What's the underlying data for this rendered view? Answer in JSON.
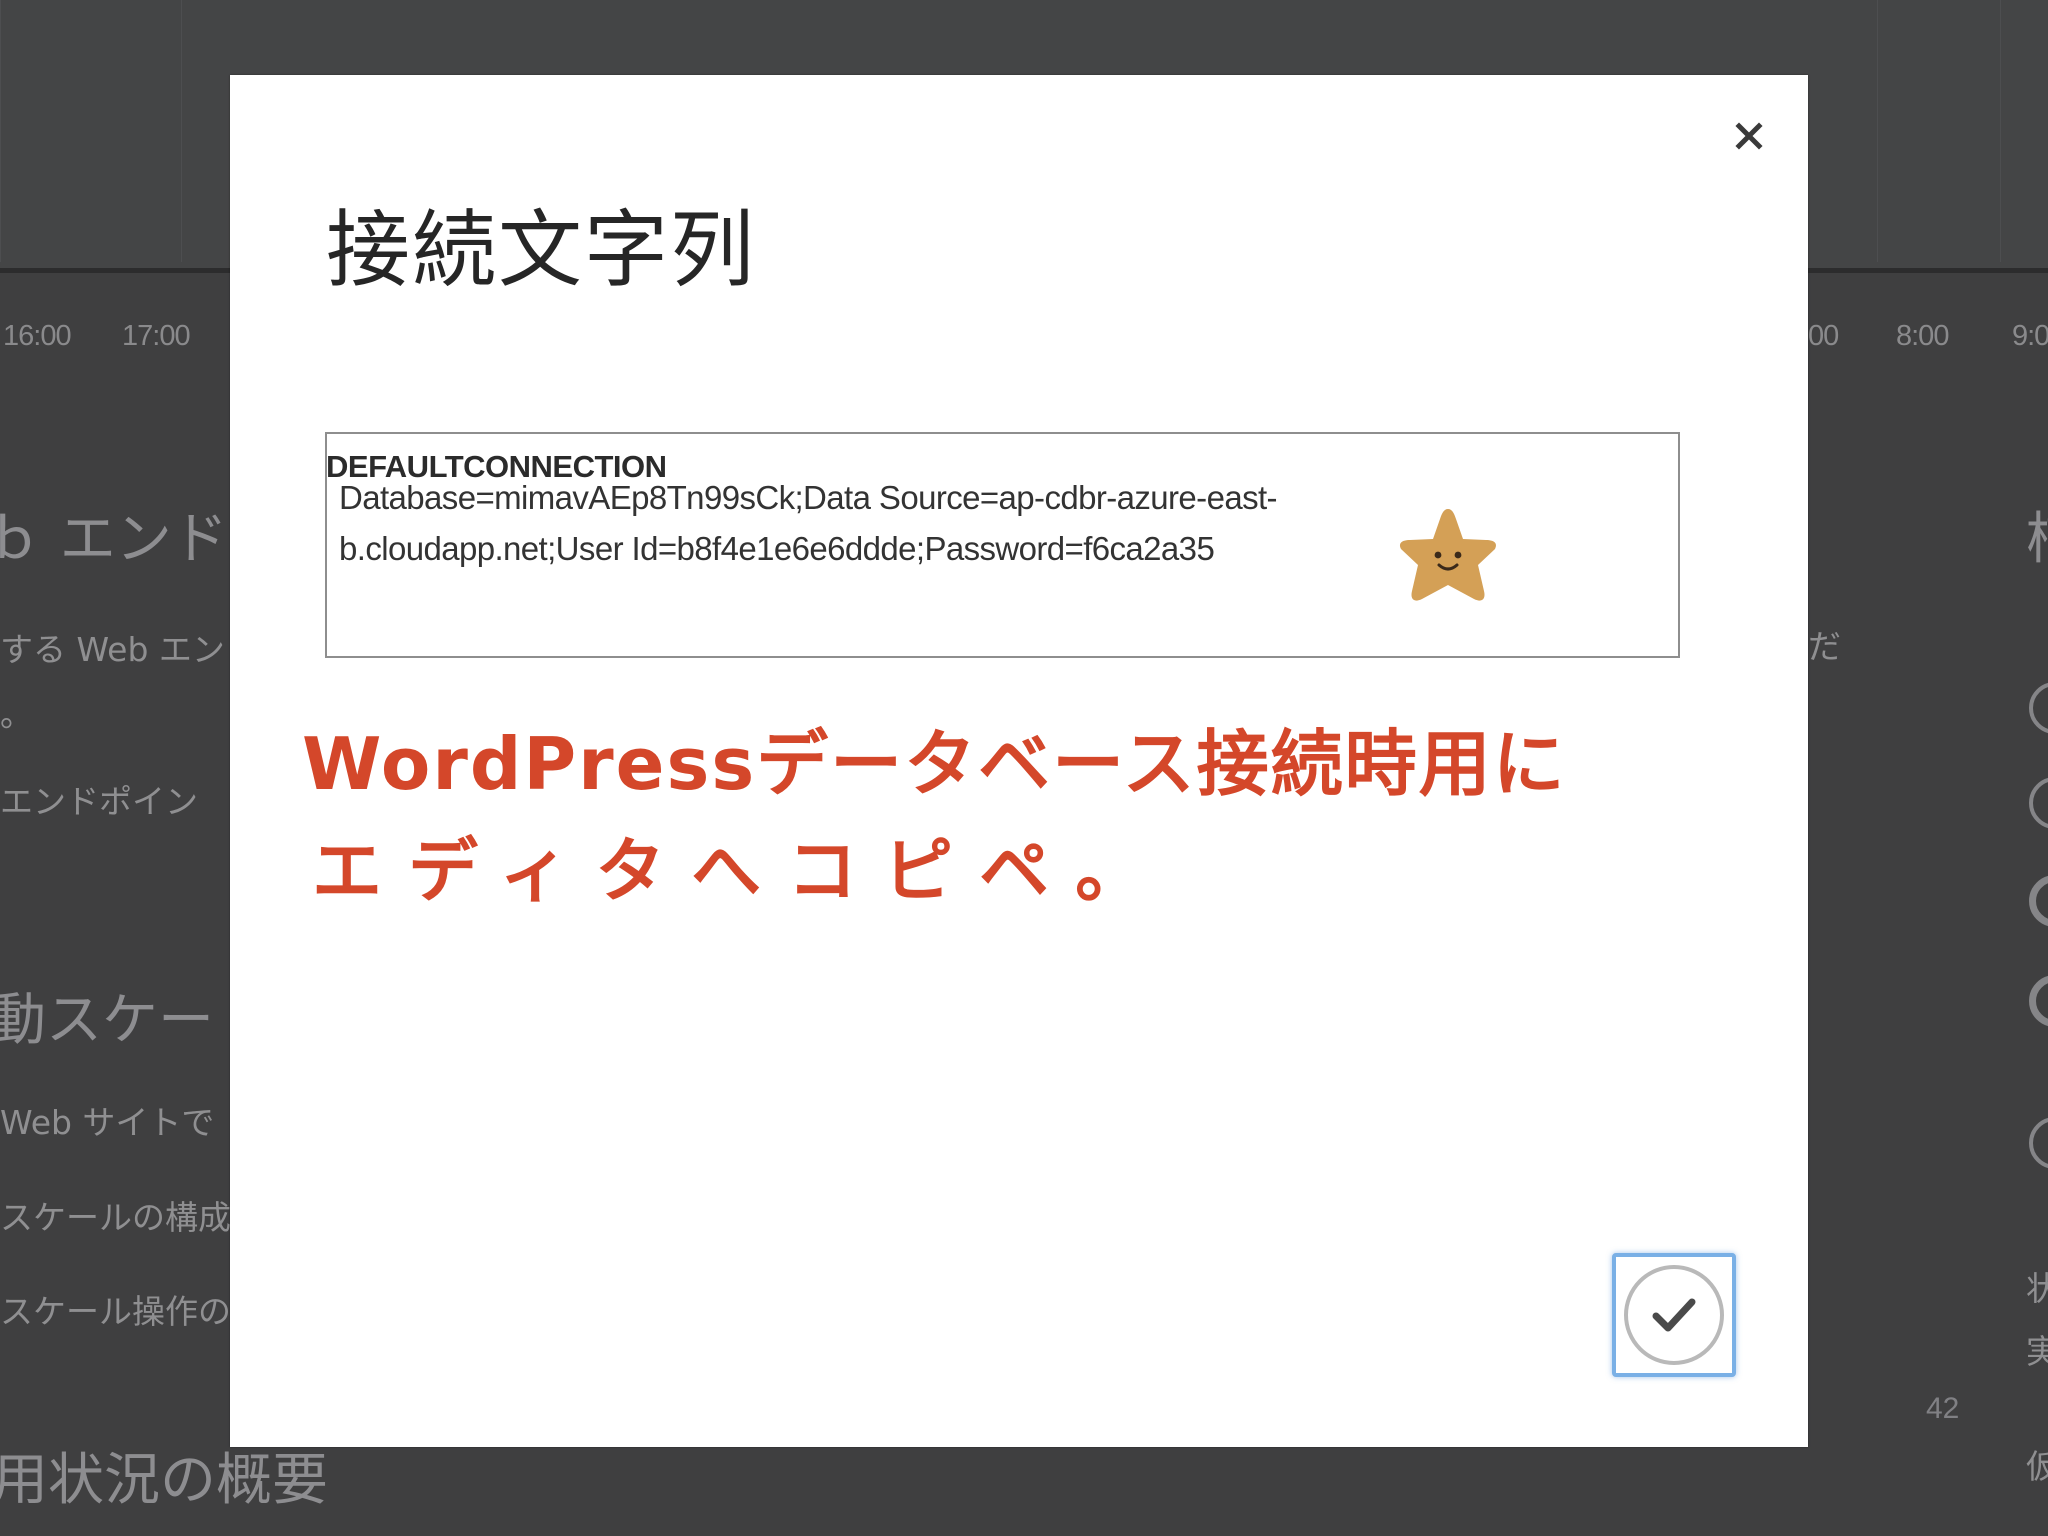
{
  "background": {
    "time_ticks": [
      "16:00",
      "17:00",
      "00",
      "8:00",
      "9:0"
    ],
    "left_texts": [
      "ｂ エンド",
      "する Web エン",
      "。",
      "エンドポイン",
      "動スケー",
      "Web サイトで",
      "スケールの構成",
      "スケール操作の",
      "用状況の概要"
    ],
    "right_texts": [
      "柿",
      "だ",
      "状",
      "実",
      "仮"
    ],
    "page_number": "42"
  },
  "dialog": {
    "title": "接続文字列",
    "field_label": "DEFAULTCONNECTION",
    "connection_string_lines": [
      "Database=mimavAEp8Tn99sCk;Data Source=ap-cdbr-azure-east-",
      "b.cloudapp.net;User Id=b8f4e1e6e6ddde;Password=f6ca2a35"
    ],
    "annotation_lines": [
      "WordPressデータベース接続時用に",
      "エディタへコピペ。"
    ],
    "close_icon": "close-x-icon",
    "confirm_icon": "checkmark-circle-icon",
    "sticker_icon": "smiling-star-icon"
  },
  "colors": {
    "overlay": "#3f3f40",
    "dialog_bg": "#ffffff",
    "annotation": "#d4472a",
    "star": "#d4a056",
    "ok_border": "#7ab0e6"
  }
}
